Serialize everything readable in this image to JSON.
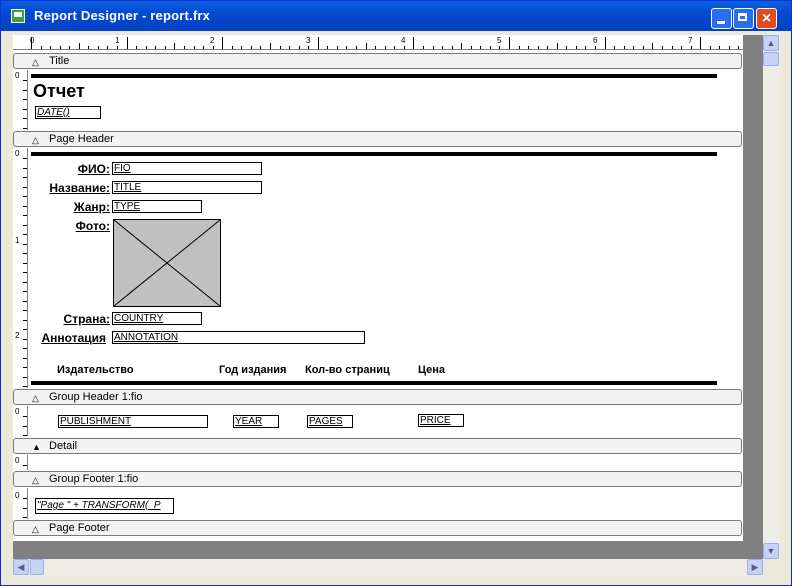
{
  "window": {
    "title": "Report Designer - report.frx",
    "close_glyph": "×"
  },
  "ruler": {
    "numbers": [
      "0",
      "1",
      "2",
      "3",
      "4",
      "5",
      "6",
      "7"
    ]
  },
  "bands": {
    "title": {
      "label": "Title",
      "text": "Отчет",
      "date_expr": "DATE()"
    },
    "page_header": {
      "label": "Page Header",
      "labels": {
        "fio": "ФИО:",
        "title": "Название:",
        "genre": "Жанр:",
        "photo": "Фото:",
        "country": "Страна:",
        "annotation": "Аннотация"
      },
      "fields": {
        "fio": "FIO",
        "title": "TITLE",
        "type": "TYPE",
        "country": "COUNTRY",
        "annotation": "ANNOTATION"
      },
      "columns": [
        "Издательство",
        "Год издания",
        "Кол-во страниц",
        "Цена"
      ]
    },
    "group_header": {
      "label": "Group Header 1:fio",
      "fields": {
        "publishment": "PUBLISHMENT",
        "year": "YEAR",
        "pages": "PAGES",
        "price": "PRICE"
      }
    },
    "detail": {
      "label": "Detail"
    },
    "group_footer": {
      "label": "Group Footer 1:fio",
      "expr": "\"Page \" + TRANSFORM(_P"
    },
    "page_footer": {
      "label": "Page Footer"
    }
  },
  "vertical_ruler_numbers": {
    "zero": "0",
    "one": "1",
    "two": "2"
  },
  "icons": {
    "collapse": "collapse-triangle-icon",
    "collapse_filled": "collapse-triangle-filled-icon"
  }
}
